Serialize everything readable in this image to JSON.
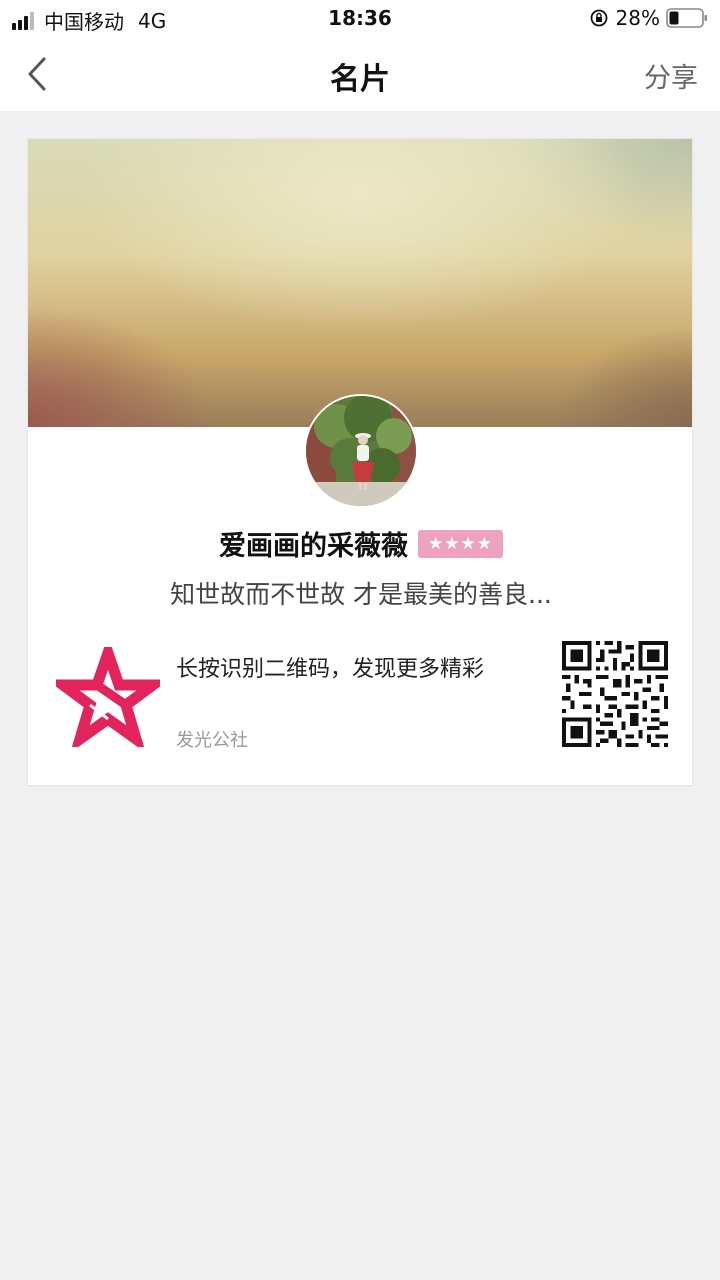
{
  "status_bar": {
    "carrier": "中国移动",
    "network": "4G",
    "time": "18:36",
    "battery": "28%"
  },
  "nav": {
    "title": "名片",
    "share_label": "分享",
    "back_icon": "chevron-left-icon"
  },
  "card": {
    "user_name": "爱画画的采薇薇",
    "level_stars": "★★★★",
    "level_stars_count": 4,
    "signature": "知世故而不世故 才是最美的善良...",
    "qr_tip": "长按识别二维码，发现更多精彩",
    "brand_name": "发光公社"
  },
  "colors": {
    "badge": "#eda3bf",
    "brand_red": "#e3245c",
    "page_bg": "#f0f0f0"
  }
}
